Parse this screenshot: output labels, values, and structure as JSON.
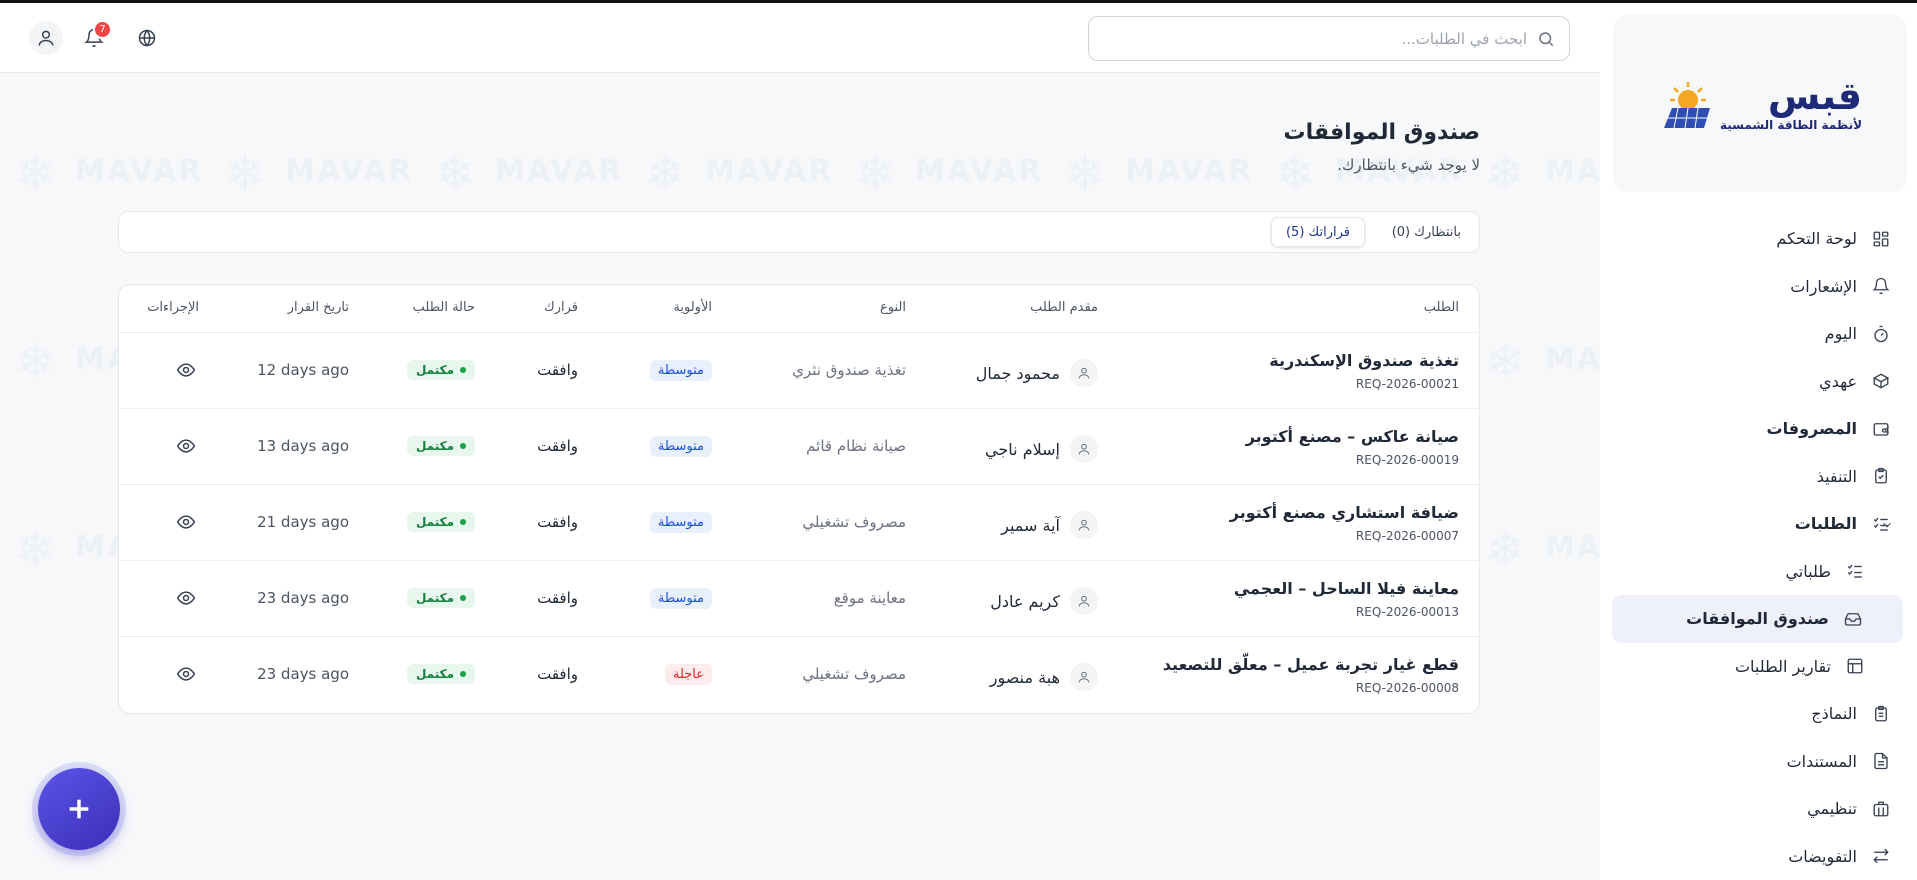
{
  "brand": {
    "logo_main": "قبس",
    "logo_sub": "لأنظمة الطاقة الشمسية",
    "accent": "#1e2a78",
    "sun_color": "#f5a623"
  },
  "search": {
    "placeholder": "ابحث في الطلبات..."
  },
  "notifications": {
    "count": "7"
  },
  "sidebar": {
    "items": [
      {
        "label": "لوحة التحكم",
        "icon": "dashboard-grid-icon"
      },
      {
        "label": "الإشعارات",
        "icon": "bell-icon"
      },
      {
        "label": "اليوم",
        "icon": "stopwatch-icon"
      },
      {
        "label": "عهدي",
        "icon": "package-box-icon"
      },
      {
        "label": "المصروفات",
        "icon": "wallet-icon"
      },
      {
        "label": "التنفيذ",
        "icon": "clipboard-check-icon"
      },
      {
        "label": "الطلبات",
        "icon": "list-checks-icon"
      },
      {
        "label": "طلباتي",
        "icon": "list-checks-icon"
      },
      {
        "label": "صندوق الموافقات",
        "icon": "inbox-icon"
      },
      {
        "label": "تقارير الطلبات",
        "icon": "table-icon"
      },
      {
        "label": "النماذج",
        "icon": "clipboard-list-icon"
      },
      {
        "label": "المستندات",
        "icon": "document-icon"
      },
      {
        "label": "تنظيمي",
        "icon": "org-building-icon"
      },
      {
        "label": "التفويضات",
        "icon": "arrows-swap-icon"
      }
    ]
  },
  "watermark": {
    "text": "MAVAR"
  },
  "page": {
    "title": "صندوق الموافقات",
    "subtitle": "لا يوجد شيء بانتظارك."
  },
  "tabs": [
    {
      "label": "بانتظارك (0)"
    },
    {
      "label": "قراراتك (5)"
    }
  ],
  "table": {
    "headers": {
      "request": "الطلب",
      "requester": "مقدم الطلب",
      "type": "النوع",
      "priority": "الأولوية",
      "decision": "قرارك",
      "status": "حالة الطلب",
      "decision_date": "تاريخ القرار",
      "actions": "الإجراءات"
    },
    "rows": [
      {
        "title": "تغذية صندوق الإسكندرية",
        "id": "REQ-2026-00021",
        "requester": "محمود جمال",
        "type": "تغذية صندوق نثري",
        "priority": "متوسطة",
        "decision": "وافقت",
        "status": "مكتمل",
        "date": "12 days ago"
      },
      {
        "title": "صيانة عاكس – مصنع أكتوبر",
        "id": "REQ-2026-00019",
        "requester": "إسلام ناجي",
        "type": "صيانة نظام قائم",
        "priority": "متوسطة",
        "decision": "وافقت",
        "status": "مكتمل",
        "date": "13 days ago"
      },
      {
        "title": "ضيافة استشاري مصنع أكتوبر",
        "id": "REQ-2026-00007",
        "requester": "آية سمير",
        "type": "مصروف تشغيلي",
        "priority": "متوسطة",
        "decision": "وافقت",
        "status": "مكتمل",
        "date": "21 days ago"
      },
      {
        "title": "معاينة فيلا الساحل – العجمي",
        "id": "REQ-2026-00013",
        "requester": "كريم عادل",
        "type": "معاينة موقع",
        "priority": "متوسطة",
        "decision": "وافقت",
        "status": "مكتمل",
        "date": "23 days ago"
      },
      {
        "title": "قطع غيار تجربة عميل – معلّق للتصعيد",
        "id": "REQ-2026-00008",
        "requester": "هبة منصور",
        "type": "مصروف تشغيلي",
        "priority": "عاجلة",
        "decision": "وافقت",
        "status": "مكتمل",
        "date": "23 days ago"
      }
    ]
  }
}
